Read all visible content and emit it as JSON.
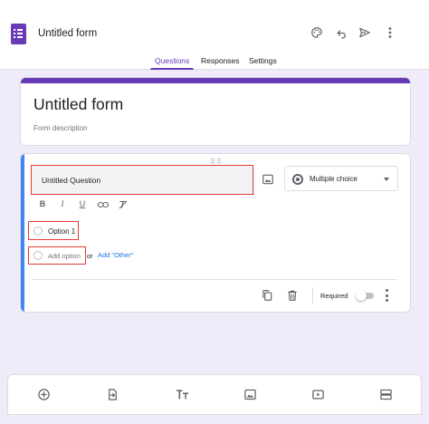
{
  "header": {
    "form_title": "Untitled form",
    "icons": [
      "forms-app-icon",
      "palette-icon",
      "undo-icon",
      "send-icon",
      "more-vert-icon"
    ],
    "tabs": [
      {
        "label": "Questions",
        "active": true
      },
      {
        "label": "Responses",
        "active": false
      },
      {
        "label": "Settings",
        "active": false
      }
    ]
  },
  "title_card": {
    "title": "Untitled form",
    "description_placeholder": "Form description"
  },
  "question": {
    "title": "Untitled Question",
    "type": "Multiple choice",
    "formatting": [
      "B",
      "I",
      "U",
      "link",
      "clear-format"
    ],
    "options": [
      {
        "label": "Option 1"
      }
    ],
    "add_option": "Add option",
    "or": "or",
    "add_other": "Add \"Other\"",
    "required_label": "Required",
    "required": false
  },
  "toolbar": {
    "icons": [
      "add-question-icon",
      "import-questions-icon",
      "add-title-icon",
      "add-image-icon",
      "add-video-icon",
      "add-section-icon"
    ]
  },
  "colors": {
    "accent": "#673ab7",
    "focus_bar": "#4285f4",
    "highlight": "#e53935",
    "background": "#f0ebf8",
    "link": "#1a73e8"
  }
}
